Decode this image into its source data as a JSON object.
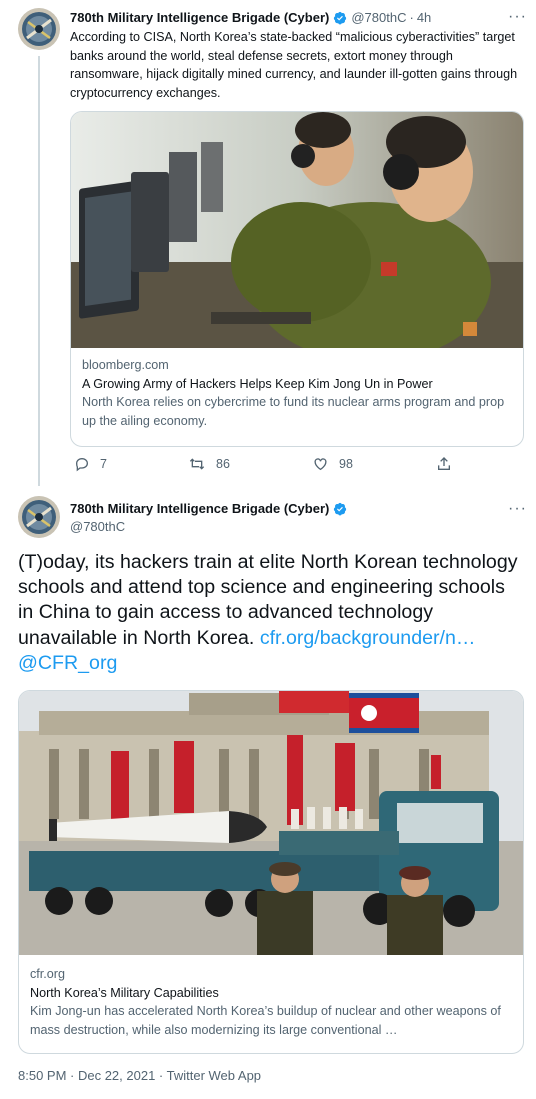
{
  "tweet1": {
    "author_name": "780th Military Intelligence Brigade (Cyber)",
    "handle": "@780thC",
    "separator": "·",
    "time_ago": "4h",
    "text": "According to CISA, North Korea’s state-backed “malicious cyberactivities” target banks around the world, steal defense secrets, extort money through ransomware, hijack digitally mined currency, and launder ill-gotten gains through cryptocurrency exchanges.",
    "card": {
      "domain": "bloomberg.com",
      "title": "A Growing Army of Hackers Helps Keep Kim Jong Un in Power",
      "description": "North Korea relies on cybercrime to fund its nuclear arms program and prop up the ailing economy."
    },
    "actions": {
      "replies": "7",
      "retweets": "86",
      "likes": "98"
    }
  },
  "tweet2": {
    "author_name": "780th Military Intelligence Brigade (Cyber)",
    "handle": "@780thC",
    "text_plain": "(T)oday, its hackers train at elite North Korean technology schools and attend top science and engineering schools in China to gain access to advanced technology unavailable in North Korea.",
    "link_text": "cfr.org/backgrounder/n…",
    "mention": "@CFR_org",
    "card": {
      "domain": "cfr.org",
      "title": "North Korea’s Military Capabilities",
      "description": "Kim Jong-un has accelerated North Korea’s buildup of nuclear and other weapons of mass destruction, while also modernizing its large conventional …"
    },
    "timestamp": "8:50 PM · Dec 22, 2021 · Twitter Web App"
  },
  "colors": {
    "text": "#0f1419",
    "secondary": "#536471",
    "link": "#1d9bf0",
    "border": "#cfd9de",
    "verified": "#1d9bf0"
  },
  "icons": [
    "verified-badge-icon",
    "more-icon",
    "reply-icon",
    "retweet-icon",
    "like-icon",
    "share-icon"
  ]
}
